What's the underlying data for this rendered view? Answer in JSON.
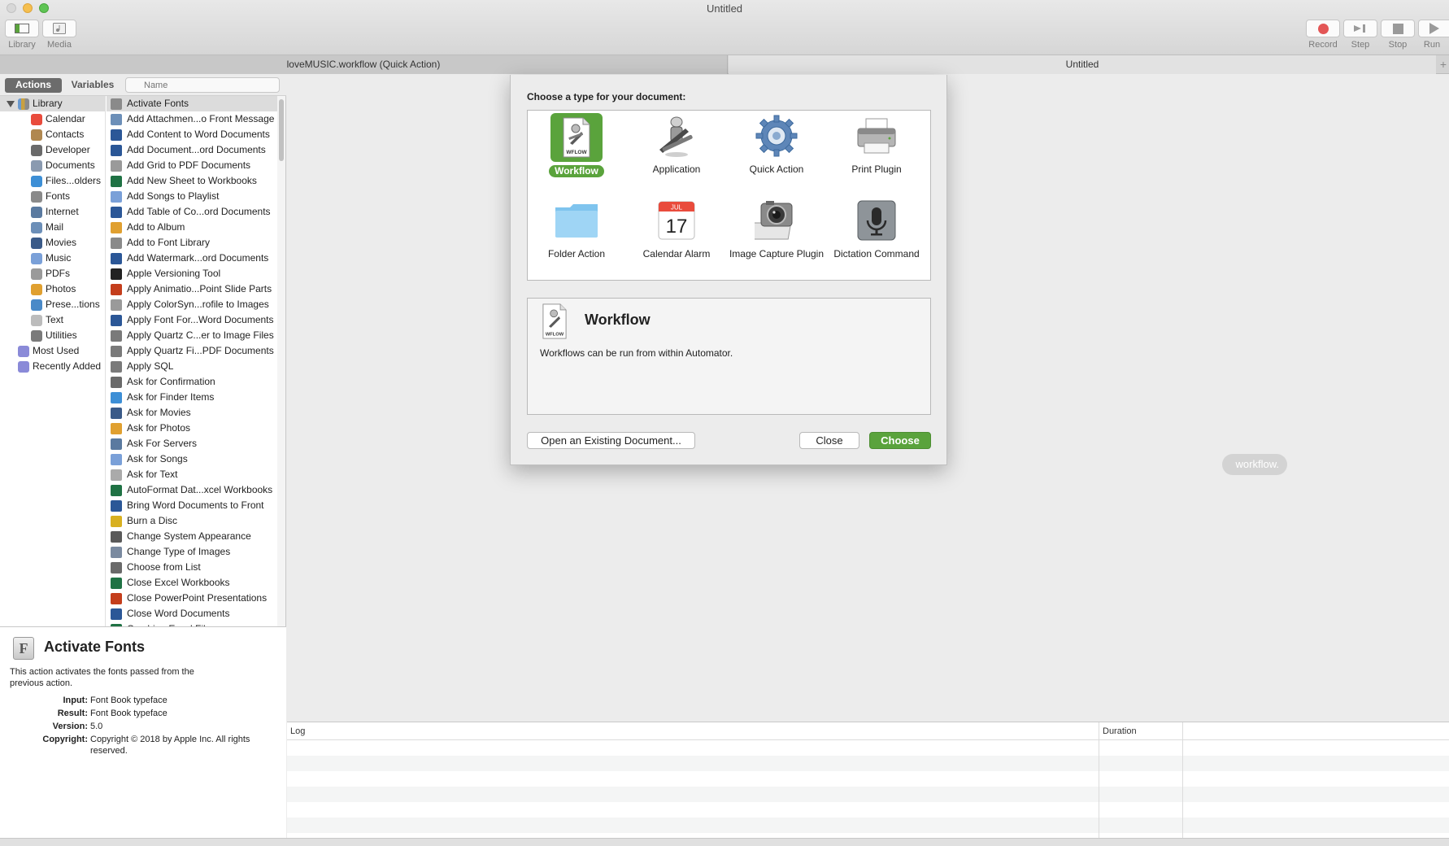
{
  "window": {
    "title": "Untitled"
  },
  "toolbar": {
    "library_label": "Library",
    "media_label": "Media",
    "record_label": "Record",
    "step_label": "Step",
    "stop_label": "Stop",
    "run_label": "Run"
  },
  "tabs": [
    {
      "label": "loveMUSIC.workflow (Quick Action)"
    },
    {
      "label": "Untitled"
    }
  ],
  "sidebar": {
    "segment_actions": "Actions",
    "segment_variables": "Variables",
    "search_placeholder": "Name",
    "library_root": "Library",
    "library_items": [
      {
        "label": "Calendar",
        "icon": "calendar-icon"
      },
      {
        "label": "Contacts",
        "icon": "contacts-icon"
      },
      {
        "label": "Developer",
        "icon": "developer-icon"
      },
      {
        "label": "Documents",
        "icon": "documents-icon"
      },
      {
        "label": "Files...olders",
        "icon": "finder-icon"
      },
      {
        "label": "Fonts",
        "icon": "fonts-icon"
      },
      {
        "label": "Internet",
        "icon": "internet-icon"
      },
      {
        "label": "Mail",
        "icon": "mail-icon"
      },
      {
        "label": "Movies",
        "icon": "movies-icon"
      },
      {
        "label": "Music",
        "icon": "music-icon"
      },
      {
        "label": "PDFs",
        "icon": "pdf-icon"
      },
      {
        "label": "Photos",
        "icon": "photos-icon"
      },
      {
        "label": "Prese...tions",
        "icon": "presentations-icon"
      },
      {
        "label": "Text",
        "icon": "text-icon"
      },
      {
        "label": "Utilities",
        "icon": "utilities-icon"
      }
    ],
    "smart_groups": [
      {
        "label": "Most Used",
        "icon": "smart-folder-icon"
      },
      {
        "label": "Recently Added",
        "icon": "smart-folder-icon"
      }
    ],
    "actions": [
      {
        "label": "Activate Fonts",
        "icon": "font-book-icon",
        "color": "#8a8a8a"
      },
      {
        "label": "Add Attachmen...o Front Message",
        "icon": "mail-icon",
        "color": "#6c8fb8"
      },
      {
        "label": "Add Content to Word Documents",
        "icon": "word-icon",
        "color": "#2b5797"
      },
      {
        "label": "Add Document...ord Documents",
        "icon": "word-icon",
        "color": "#2b5797"
      },
      {
        "label": "Add Grid to PDF Documents",
        "icon": "pdf-icon",
        "color": "#9a9a9a"
      },
      {
        "label": "Add New Sheet to Workbooks",
        "icon": "excel-icon",
        "color": "#1f7244"
      },
      {
        "label": "Add Songs to Playlist",
        "icon": "music-icon",
        "color": "#7aa0d8"
      },
      {
        "label": "Add Table of Co...ord Documents",
        "icon": "word-icon",
        "color": "#2b5797"
      },
      {
        "label": "Add to Album",
        "icon": "photos-icon",
        "color": "#e0a030"
      },
      {
        "label": "Add to Font Library",
        "icon": "font-book-icon",
        "color": "#8a8a8a"
      },
      {
        "label": "Add Watermark...ord Documents",
        "icon": "word-icon",
        "color": "#2b5797"
      },
      {
        "label": "Apple Versioning Tool",
        "icon": "terminal-icon",
        "color": "#222222"
      },
      {
        "label": "Apply Animatio...Point Slide Parts",
        "icon": "powerpoint-icon",
        "color": "#c43e1c"
      },
      {
        "label": "Apply ColorSyn...rofile to Images",
        "icon": "colorsync-icon",
        "color": "#9a9a9a"
      },
      {
        "label": "Apply Font For...Word Documents",
        "icon": "word-icon",
        "color": "#2b5797"
      },
      {
        "label": "Apply Quartz C...er to Image Files",
        "icon": "utilities-icon",
        "color": "#7a7a7a"
      },
      {
        "label": "Apply Quartz Fi...PDF Documents",
        "icon": "utilities-icon",
        "color": "#7a7a7a"
      },
      {
        "label": "Apply SQL",
        "icon": "utilities-icon",
        "color": "#7a7a7a"
      },
      {
        "label": "Ask for Confirmation",
        "icon": "automator-icon",
        "color": "#6a6a6a"
      },
      {
        "label": "Ask for Finder Items",
        "icon": "finder-icon",
        "color": "#3d8fd6"
      },
      {
        "label": "Ask for Movies",
        "icon": "movies-icon",
        "color": "#3a5a88"
      },
      {
        "label": "Ask for Photos",
        "icon": "photos-icon",
        "color": "#e0a030"
      },
      {
        "label": "Ask For Servers",
        "icon": "internet-icon",
        "color": "#5a7aa0"
      },
      {
        "label": "Ask for Songs",
        "icon": "music-icon",
        "color": "#7aa0d8"
      },
      {
        "label": "Ask for Text",
        "icon": "text-icon",
        "color": "#aaaaaa"
      },
      {
        "label": "AutoFormat Dat...xcel Workbooks",
        "icon": "excel-icon",
        "color": "#1f7244"
      },
      {
        "label": "Bring Word Documents to Front",
        "icon": "word-icon",
        "color": "#2b5797"
      },
      {
        "label": "Burn a Disc",
        "icon": "burn-icon",
        "color": "#d8b020"
      },
      {
        "label": "Change System Appearance",
        "icon": "system-icon",
        "color": "#5a5a5a"
      },
      {
        "label": "Change Type of Images",
        "icon": "preview-icon",
        "color": "#7a8aa0"
      },
      {
        "label": "Choose from List",
        "icon": "automator-icon",
        "color": "#6a6a6a"
      },
      {
        "label": "Close Excel Workbooks",
        "icon": "excel-icon",
        "color": "#1f7244"
      },
      {
        "label": "Close PowerPoint Presentations",
        "icon": "powerpoint-icon",
        "color": "#c43e1c"
      },
      {
        "label": "Close Word Documents",
        "icon": "word-icon",
        "color": "#2b5797"
      },
      {
        "label": "Combine Excel Files",
        "icon": "excel-icon",
        "color": "#1f7244"
      }
    ]
  },
  "info": {
    "title": "Activate Fonts",
    "description": "This action activates the fonts passed from the previous action.",
    "input_key": "Input:",
    "input_value": "Font Book typeface",
    "result_key": "Result:",
    "result_value": "Font Book typeface",
    "version_key": "Version:",
    "version_value": "5.0",
    "copyright_key": "Copyright:",
    "copyright_value": "Copyright © 2018 by Apple Inc. All rights reserved."
  },
  "main": {
    "hint_fragment": "workflow."
  },
  "log": {
    "col_log": "Log",
    "col_duration": "Duration"
  },
  "dialog": {
    "prompt": "Choose a type for your document:",
    "types": [
      {
        "label": "Workflow",
        "icon": "workflow-icon",
        "selected": true
      },
      {
        "label": "Application",
        "icon": "application-icon"
      },
      {
        "label": "Quick Action",
        "icon": "gear-icon"
      },
      {
        "label": "Print Plugin",
        "icon": "printer-icon"
      },
      {
        "label": "Folder Action",
        "icon": "folder-icon"
      },
      {
        "label": "Calendar Alarm",
        "icon": "calendar-icon",
        "calendar_month": "JUL",
        "calendar_day": "17"
      },
      {
        "label": "Image Capture Plugin",
        "icon": "camera-icon"
      },
      {
        "label": "Dictation Command",
        "icon": "microphone-icon"
      }
    ],
    "workflow_badge": "WFLOW",
    "selected_title": "Workflow",
    "selected_description": "Workflows can be run from within Automator.",
    "open_button": "Open an Existing Document...",
    "close_button": "Close",
    "choose_button": "Choose"
  },
  "colors": {
    "accent_green": "#5aa33c",
    "selection_gray": "#dcdcdc"
  }
}
